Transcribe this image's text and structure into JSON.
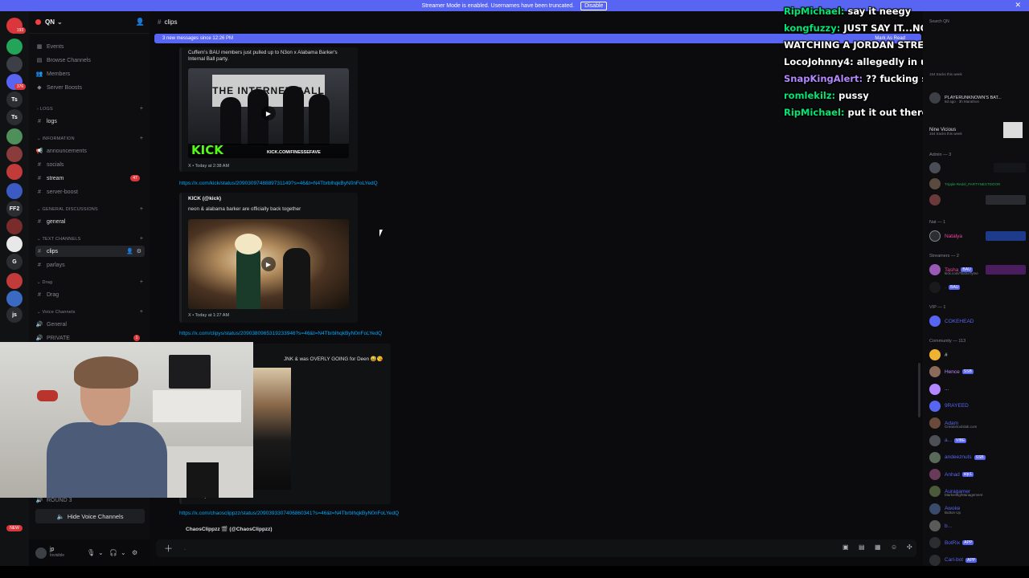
{
  "banner": {
    "text": "Streamer Mode is enabled. Usernames have been truncated.",
    "disable_label": "Disable",
    "close_glyph": "✕"
  },
  "server_rail": {
    "items": [
      {
        "label": "",
        "color": "#da373c",
        "badge": "193"
      },
      {
        "label": "",
        "color": "#23a559",
        "badge": ""
      },
      {
        "label": "",
        "color": "#3c3f45",
        "badge": ""
      },
      {
        "label": "",
        "color": "#5865f2",
        "badge": "376"
      },
      {
        "label": "Ts",
        "color": "#2b2d31",
        "badge": ""
      },
      {
        "label": "Ts",
        "color": "#2b2d31",
        "badge": ""
      },
      {
        "label": "",
        "color": "#4e8f5a",
        "badge": ""
      },
      {
        "label": "",
        "color": "#8a3b3b",
        "badge": ""
      },
      {
        "label": "",
        "color": "#c23b3b",
        "badge": ""
      },
      {
        "label": "",
        "color": "#3b5bc2",
        "badge": ""
      },
      {
        "label": "FF2",
        "color": "#2b2d31",
        "badge": ""
      },
      {
        "label": "",
        "color": "#7a2b2b",
        "badge": ""
      },
      {
        "label": "",
        "color": "#e8e8e8",
        "badge": ""
      },
      {
        "label": "G",
        "color": "#2b2d31",
        "badge": ""
      },
      {
        "label": "",
        "color": "#c23b3b",
        "badge": ""
      },
      {
        "label": "",
        "color": "#3b6ac2",
        "badge": ""
      },
      {
        "label": "js",
        "color": "#2b2d31",
        "badge": ""
      }
    ],
    "new_label": "NEW"
  },
  "guild": {
    "name": "QN"
  },
  "sidebar": {
    "top_items": [
      {
        "icon": "▦",
        "label": "Events"
      },
      {
        "icon": "▤",
        "label": "Browse Channels"
      },
      {
        "icon": "👥",
        "label": "Members"
      },
      {
        "icon": "◆",
        "label": "Server Boosts"
      }
    ],
    "cat_logs": "LOGS",
    "logs": "logs",
    "cat_information": "INFORMATION",
    "info_channels": [
      "announcements",
      "socials",
      "stream",
      "server-boost"
    ],
    "stream_badge": "47",
    "cat_general": "GENERAL DISCUSSIONS",
    "general": "general",
    "cat_text": "TEXT CHANNELS",
    "clips": "clips",
    "parlays": "parlays",
    "cat_drag": "Drag",
    "drag": "Drag",
    "cat_voice": "Voice Channels",
    "voice_general": "General",
    "voice_private": "PRIVATE",
    "private_badge": "1",
    "round": "ROUND 3",
    "hide_voice": "Hide Voice Channels"
  },
  "user": {
    "name": "jp",
    "status": "Invisible"
  },
  "chat": {
    "channel": "clips",
    "new_messages": "3 new messages since 12:26 PM",
    "mark_read": "Mark As Read",
    "msg1_text_1": "Cuffem's BAU members just pulled up to N3on x Alabama Barker's",
    "msg1_text_2": "Internal Ball party.",
    "embed1_footer": "X • Today at 2:38 AM",
    "media1_wall": "THE INTERNET BALL",
    "kick_logo": "KICK",
    "kick_url": "KICK.COM/FINESSEFAVE",
    "link1": "https://x.com/kick/status/2090309748889731149?s=46&t=N4TbrblhqkByN0nFoLYedQ",
    "embed2_author": "KICK (@kick)",
    "embed2_desc": "neon & alabama barker are officially back together",
    "embed2_footer": "X • Today at 1:27 AM",
    "link2": "https://x.com/clipys/status/2090380965319233946?s=46&t=N4TbrblhqkByN0nFoLYedQ",
    "partial_text": "JNK & was OVERLY GOING for Deen 😅😘",
    "embed3_footer": "X • Today at 6:10 AM",
    "link3": "https://x.com/chaosclippzz/status/2090393307406860341?s=46&t=N4TbrblhqkByN0nFoLYedQ",
    "last_author": "ChaosClippzz 🎬 (@ChaosClippzz)",
    "composer_placeholder": "."
  },
  "overlay_chat": [
    {
      "user": "RipMichael:",
      "color": "#00e676",
      "text": "say it neegy"
    },
    {
      "user": "kongfuzzy:",
      "color": "#00e676",
      "text": "JUST SAY IT...NOBODY IS"
    },
    {
      "user": "",
      "color": "#ffffff",
      "text": "WATCHING A JORDAN STREAM"
    },
    {
      "user": "LocoJohnny4:",
      "color": "#ffffff",
      "text": "allegedly in ur opinion"
    },
    {
      "user": "SnapKingAlert:",
      "color": "#b388ff",
      "text": "?? fucking say iut"
    },
    {
      "user": "romlekilz:",
      "color": "#00e676",
      "text": "pussy"
    },
    {
      "user": "RipMichael:",
      "color": "#00e676",
      "text": "put it out there"
    }
  ],
  "members": {
    "search": "Search QN",
    "activity_1": "PLAYERUNKNOWN'S BAT...",
    "activity_1_sub": "8d ago · 3h Marathon",
    "activity_2": "Nine Vicious",
    "activity_2_sub": "154 tracks this week",
    "activity_0_sub": "154 tracks this week",
    "group_admin": "Admin — 3",
    "admin_sub": "Tripple Red4l_PARTYNEXTDOOR",
    "group_nat": "Nat — 1",
    "nat_name": "Natalya",
    "group_streamers": "Streamers — 2",
    "streamer1": "Tasha",
    "streamer1_tag": "BAU",
    "streamer1_sub": "kick.com/TashaTyme",
    "streamer2_tag": "BAU",
    "group_vip": "VIP — 1",
    "vip_name": "COKEHEAD",
    "group_community": "Community — 113",
    "community": [
      {
        "name": "#",
        "color": "#dbdee1",
        "tag": "",
        "sub": ""
      },
      {
        "name": "Hence",
        "color": "#b388ff",
        "tag": "SSB",
        "sub": ""
      },
      {
        "name": "...",
        "color": "#b388ff",
        "tag": "",
        "sub": ""
      },
      {
        "name": "9RAYEED",
        "color": "#5865f2",
        "tag": "",
        "sub": ""
      },
      {
        "name": "Adam",
        "color": "#5865f2",
        "tag": "",
        "sub": "Creatortoolslab.com"
      },
      {
        "name": "a...",
        "color": "#5865f2",
        "tag": "VIBE",
        "sub": ""
      },
      {
        "name": "andeeznuts",
        "color": "#5865f2",
        "tag": "SSB",
        "sub": ""
      },
      {
        "name": "Anhad",
        "color": "#5865f2",
        "tag": "sqcL",
        "sub": ""
      },
      {
        "name": "Auragamer",
        "color": "#5865f2",
        "tag": "",
        "sub": "Marketing/Management"
      },
      {
        "name": "Awoke",
        "color": "#5865f2",
        "tag": "",
        "sub": "Button Up"
      },
      {
        "name": "b...",
        "color": "#5865f2",
        "tag": "",
        "sub": ""
      },
      {
        "name": "BotRix",
        "color": "#5865f2",
        "tag": "APP",
        "sub": ""
      },
      {
        "name": "Carl-bot",
        "color": "#5865f2",
        "tag": "APP",
        "sub": ""
      }
    ]
  }
}
